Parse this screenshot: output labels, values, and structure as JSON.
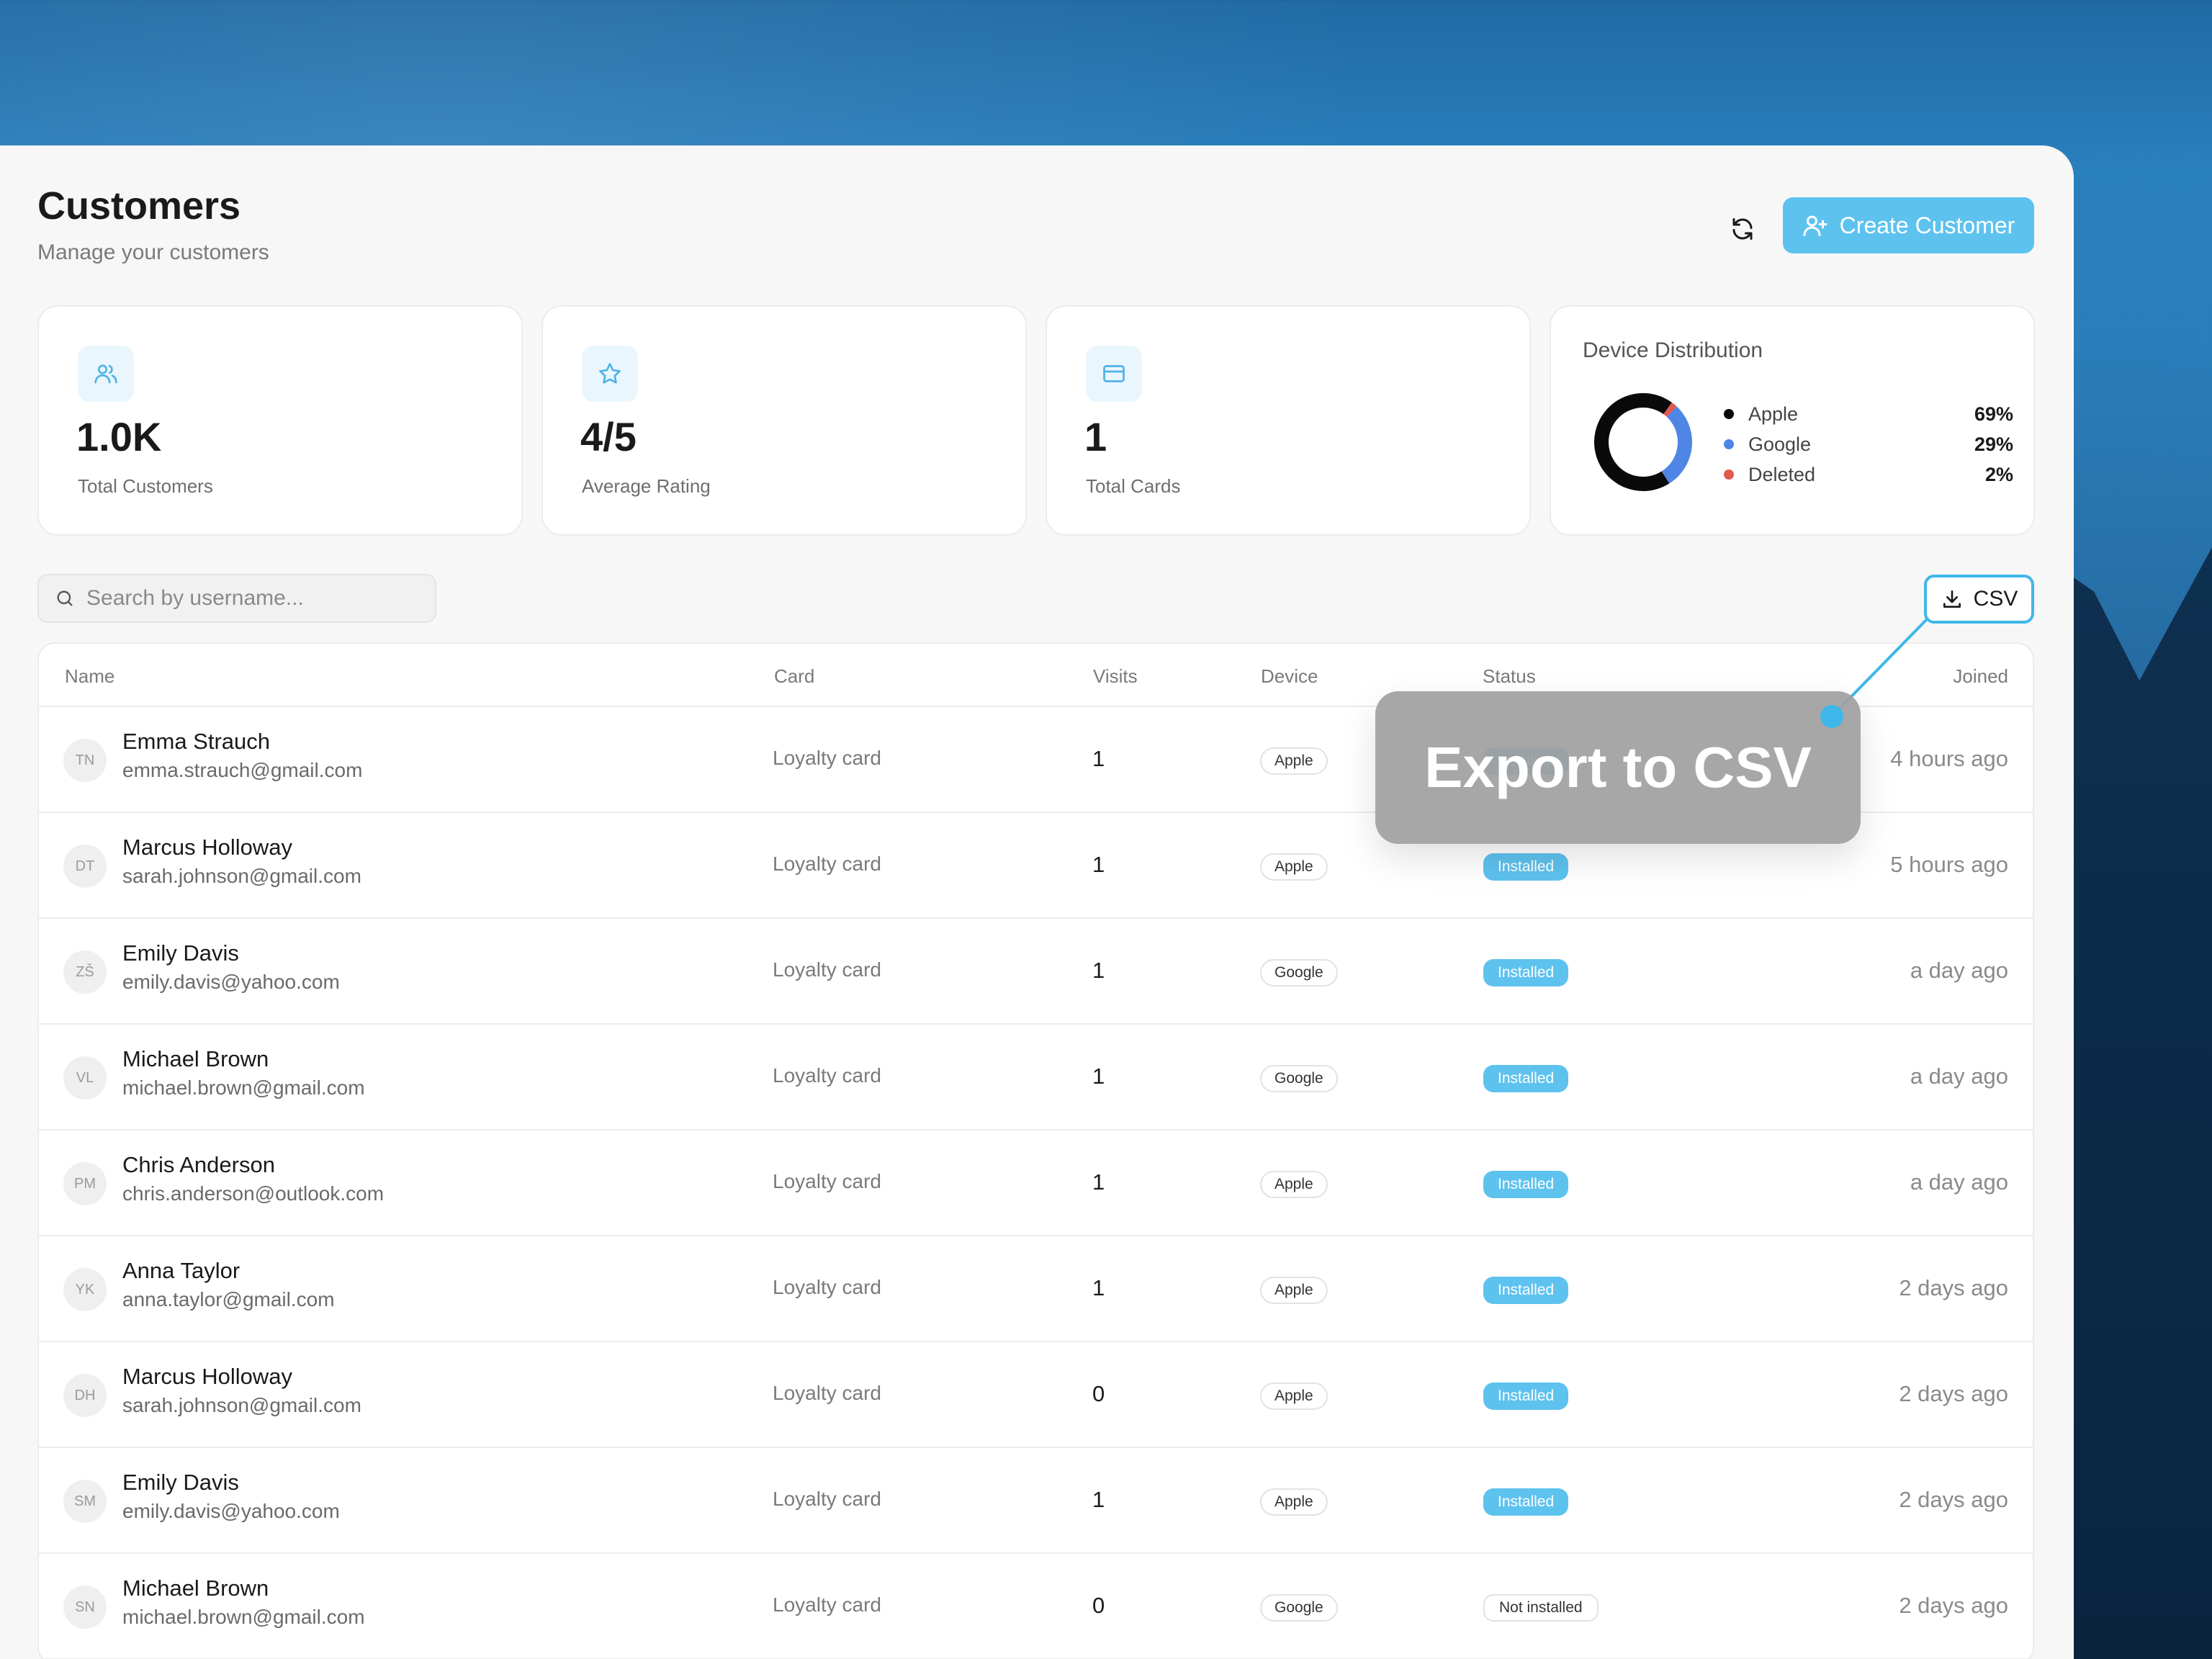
{
  "header": {
    "title": "Customers",
    "subtitle": "Manage your customers",
    "create_label": "Create Customer"
  },
  "stats": [
    {
      "value": "1.0K",
      "label": "Total Customers",
      "icon": "users-icon"
    },
    {
      "value": "4/5",
      "label": "Average Rating",
      "icon": "star-icon"
    },
    {
      "value": "1",
      "label": "Total Cards",
      "icon": "credit-card-icon"
    }
  ],
  "distribution": {
    "title": "Device Distribution",
    "items": [
      {
        "name": "Apple",
        "pct": "69%",
        "value": 69,
        "color": "#0a0a0a"
      },
      {
        "name": "Google",
        "pct": "29%",
        "value": 29,
        "color": "#4f86e6"
      },
      {
        "name": "Deleted",
        "pct": "2%",
        "value": 2,
        "color": "#e05a50"
      }
    ]
  },
  "search": {
    "placeholder": "Search by username..."
  },
  "csv_label": "CSV",
  "tooltip": "Export to CSV",
  "columns": {
    "name": "Name",
    "card": "Card",
    "visits": "Visits",
    "device": "Device",
    "status": "Status",
    "joined": "Joined"
  },
  "rows": [
    {
      "initials": "TN",
      "name": "Emma Strauch",
      "email": "emma.strauch@gmail.com",
      "card": "Loyalty card",
      "visits": "1",
      "device": "Apple",
      "status": "Installed",
      "installed": true,
      "joined": "4 hours ago"
    },
    {
      "initials": "DT",
      "name": "Marcus Holloway",
      "email": "sarah.johnson@gmail.com",
      "card": "Loyalty card",
      "visits": "1",
      "device": "Apple",
      "status": "Installed",
      "installed": true,
      "joined": "5 hours ago"
    },
    {
      "initials": "ZŠ",
      "name": "Emily Davis",
      "email": "emily.davis@yahoo.com",
      "card": "Loyalty card",
      "visits": "1",
      "device": "Google",
      "status": "Installed",
      "installed": true,
      "joined": "a day ago"
    },
    {
      "initials": "VL",
      "name": "Michael Brown",
      "email": "michael.brown@gmail.com",
      "card": "Loyalty card",
      "visits": "1",
      "device": "Google",
      "status": "Installed",
      "installed": true,
      "joined": "a day ago"
    },
    {
      "initials": "PM",
      "name": "Chris Anderson",
      "email": "chris.anderson@outlook.com",
      "card": "Loyalty card",
      "visits": "1",
      "device": "Apple",
      "status": "Installed",
      "installed": true,
      "joined": "a day ago"
    },
    {
      "initials": "YK",
      "name": "Anna Taylor",
      "email": "anna.taylor@gmail.com",
      "card": "Loyalty card",
      "visits": "1",
      "device": "Apple",
      "status": "Installed",
      "installed": true,
      "joined": "2 days ago"
    },
    {
      "initials": "DH",
      "name": "Marcus Holloway",
      "email": "sarah.johnson@gmail.com",
      "card": "Loyalty card",
      "visits": "0",
      "device": "Apple",
      "status": "Installed",
      "installed": true,
      "joined": "2 days ago"
    },
    {
      "initials": "SM",
      "name": "Emily Davis",
      "email": "emily.davis@yahoo.com",
      "card": "Loyalty card",
      "visits": "1",
      "device": "Apple",
      "status": "Installed",
      "installed": true,
      "joined": "2 days ago"
    },
    {
      "initials": "SN",
      "name": "Michael Brown",
      "email": "michael.brown@gmail.com",
      "card": "Loyalty card",
      "visits": "0",
      "device": "Google",
      "status": "Not installed",
      "installed": false,
      "joined": "2 days ago"
    }
  ]
}
